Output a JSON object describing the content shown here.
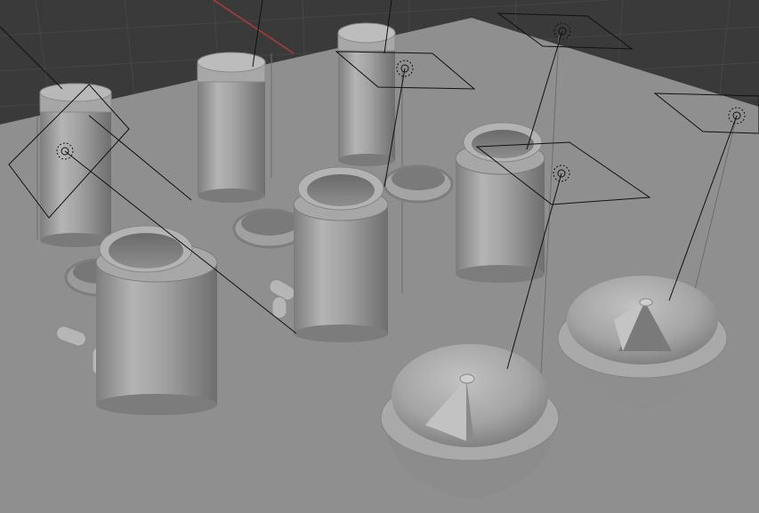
{
  "viewport": {
    "mode": "3d-viewport",
    "shading": "solid",
    "colors": {
      "background": "#3a3a3a",
      "grid_line": "#464646",
      "x_axis": "#b03a3a",
      "y_axis": "#6aa33a",
      "ground": "#8f8f8f",
      "object_light": "#b2b2b2",
      "object_mid": "#999999",
      "object_dark": "#7c7c7c",
      "light_gizmo": "#111111"
    }
  },
  "objects": [
    {
      "name": "bottle-closed-1",
      "type": "mesh",
      "icon": "cylinder-mesh"
    },
    {
      "name": "bottle-closed-2",
      "type": "mesh",
      "icon": "cylinder-mesh"
    },
    {
      "name": "bottle-closed-3",
      "type": "mesh",
      "icon": "cylinder-mesh"
    },
    {
      "name": "jar-open-1",
      "type": "mesh",
      "icon": "cylinder-mesh"
    },
    {
      "name": "jar-open-2",
      "type": "mesh",
      "icon": "cylinder-mesh"
    },
    {
      "name": "jar-open-3",
      "type": "mesh",
      "icon": "cylinder-mesh"
    },
    {
      "name": "cap-ring-1",
      "type": "mesh",
      "icon": "torus-mesh"
    },
    {
      "name": "cap-ring-2",
      "type": "mesh",
      "icon": "torus-mesh"
    },
    {
      "name": "cap-ring-3",
      "type": "mesh",
      "icon": "torus-mesh"
    },
    {
      "name": "dome-dispenser-1",
      "type": "mesh",
      "icon": "sphere-mesh"
    },
    {
      "name": "dome-dispenser-2",
      "type": "mesh",
      "icon": "sphere-mesh"
    },
    {
      "name": "pills",
      "type": "mesh",
      "icon": "capsule-mesh"
    },
    {
      "name": "area-light",
      "type": "light",
      "icon": "light-icon"
    }
  ]
}
